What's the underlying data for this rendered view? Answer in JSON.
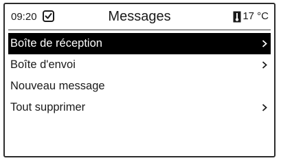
{
  "header": {
    "time": "09:20",
    "title": "Messages",
    "temperature": "17 °C",
    "status_icon": "message-check-icon",
    "temperature_icon": "thermometer-icon"
  },
  "menu": {
    "items": [
      {
        "label": "Boîte de réception",
        "selected": true,
        "has_submenu": true
      },
      {
        "label": "Boîte d'envoi",
        "selected": false,
        "has_submenu": true
      },
      {
        "label": "Nouveau message",
        "selected": false,
        "has_submenu": false
      },
      {
        "label": "Tout supprimer",
        "selected": false,
        "has_submenu": true
      }
    ]
  },
  "colors": {
    "selection_background": "#000000",
    "selection_text": "#ffffff",
    "text": "#1a1a1a",
    "background": "#ffffff"
  }
}
